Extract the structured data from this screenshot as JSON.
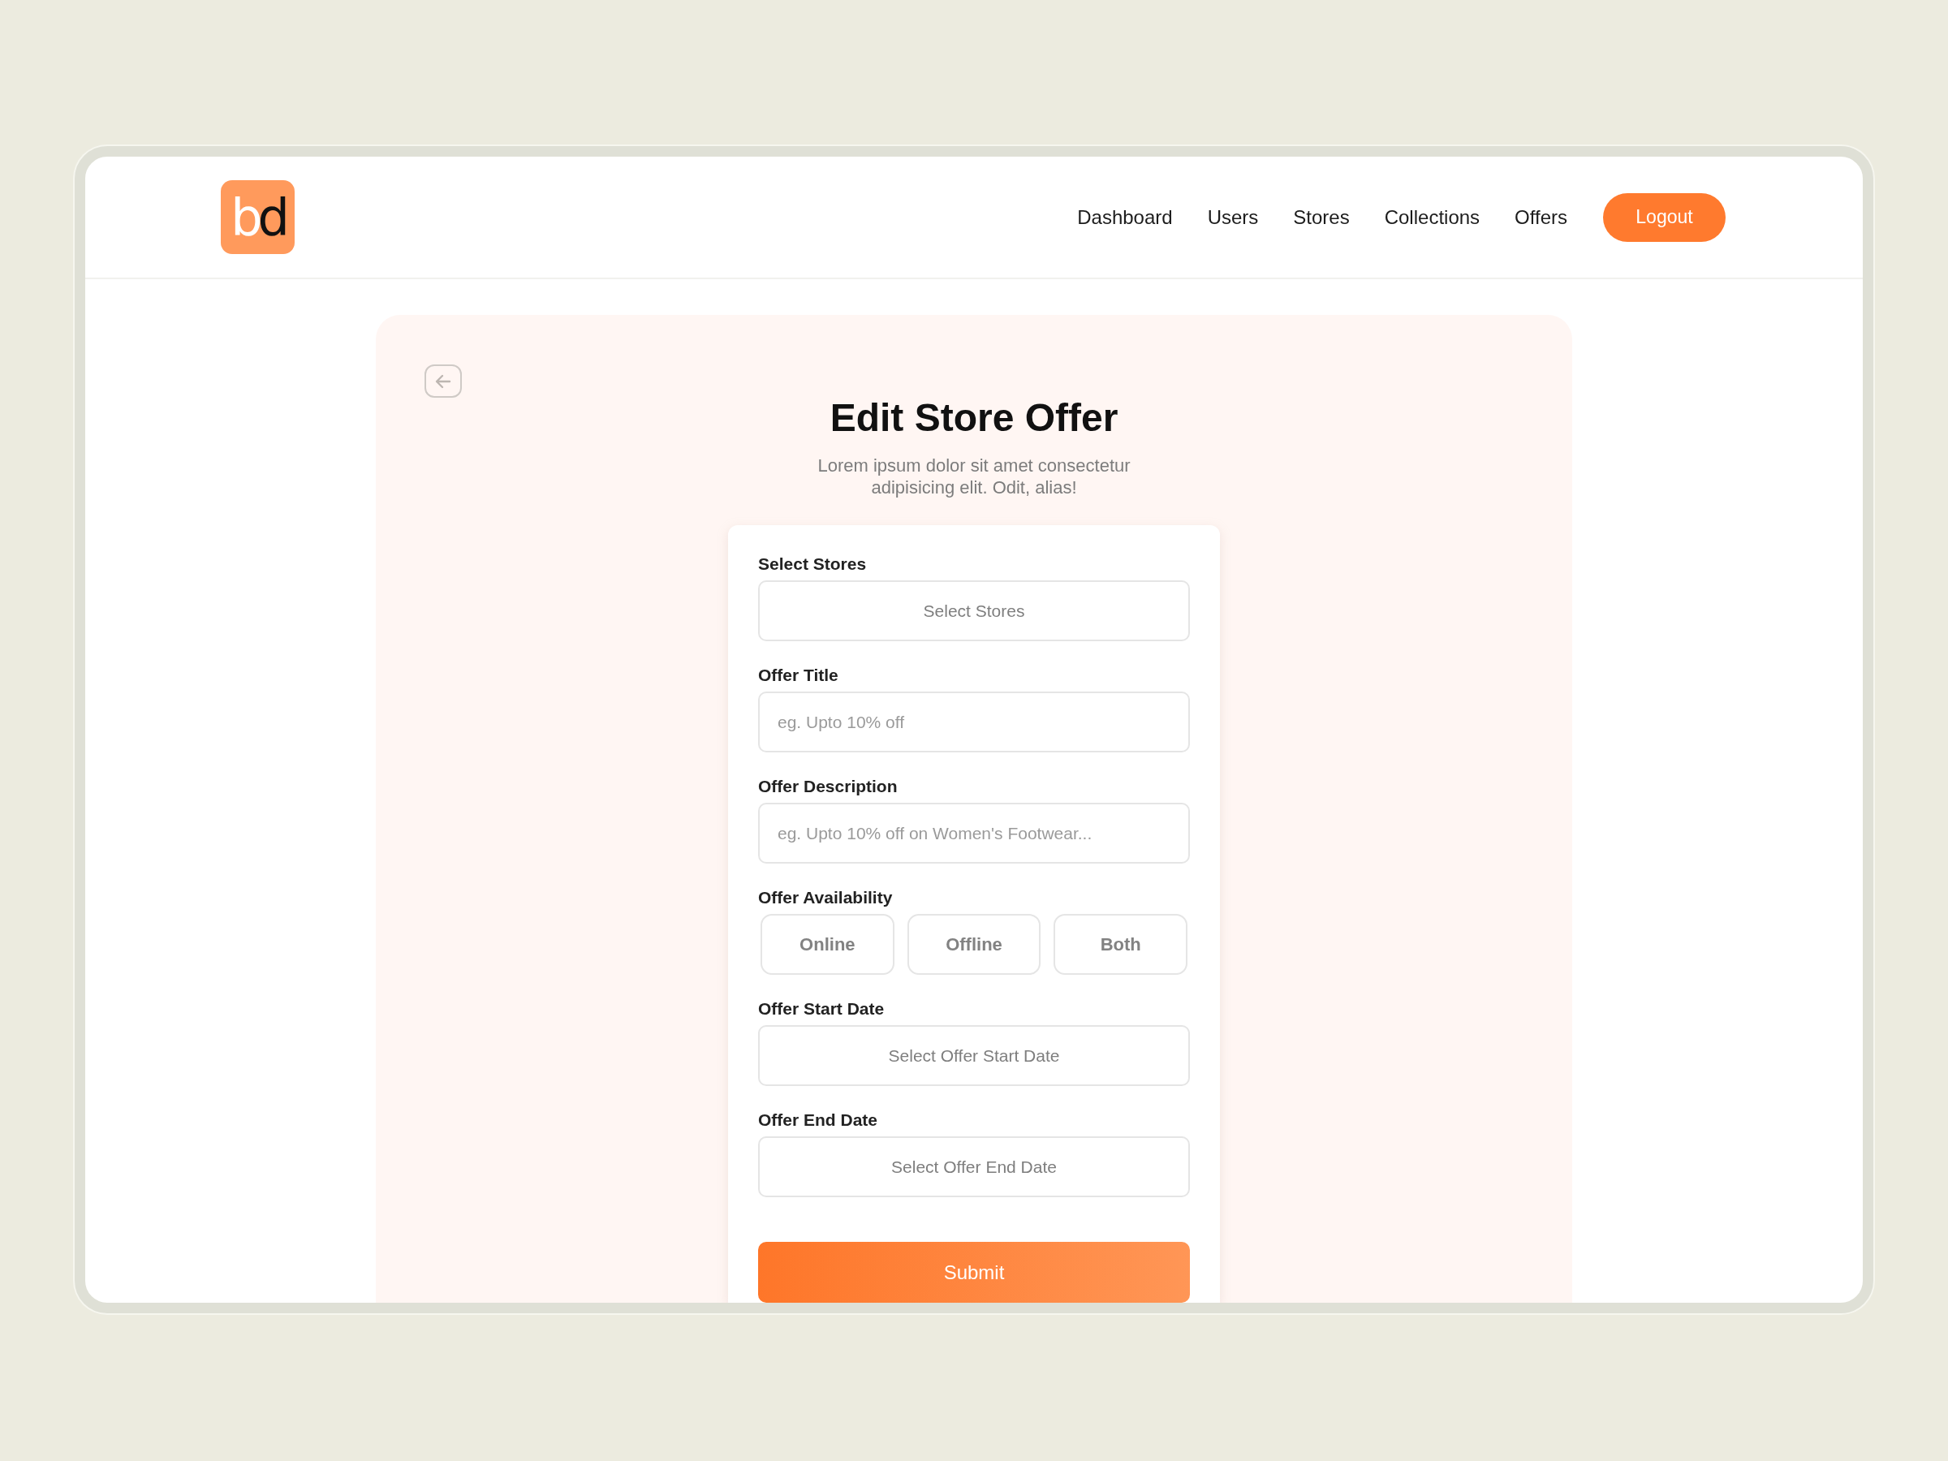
{
  "header": {
    "logo": {
      "letters": [
        {
          "char": "b",
          "color": "#ffffff"
        },
        {
          "char": "d",
          "color": "#111111"
        }
      ]
    },
    "nav": [
      {
        "label": "Dashboard",
        "selected": false
      },
      {
        "label": "Users",
        "selected": false
      },
      {
        "label": "Stores",
        "selected": false
      },
      {
        "label": "Collections",
        "selected": false
      },
      {
        "label": "Offers",
        "selected": false
      }
    ],
    "logout": "Logout"
  },
  "page": {
    "title": "Edit Store Offer",
    "subtitle": "Lorem ipsum dolor sit amet consectetur adipisicing elit. Odit, alias!"
  },
  "form": {
    "fields": [
      {
        "kind": "picker",
        "label": "Select Stores",
        "placeholder": "Select Stores"
      },
      {
        "kind": "text",
        "label": "Offer Title",
        "placeholder": "eg. Upto 10% off"
      },
      {
        "kind": "text",
        "label": "Offer Description",
        "placeholder": "eg. Upto 10% off on Women's Footwear..."
      },
      {
        "kind": "choice",
        "label": "Offer Availability",
        "options": [
          {
            "label": "Online",
            "selected": false
          },
          {
            "label": "Offline",
            "selected": false
          },
          {
            "label": "Both",
            "selected": false
          }
        ]
      },
      {
        "kind": "picker",
        "label": "Offer Start Date",
        "placeholder": "Select Offer Start Date"
      },
      {
        "kind": "picker",
        "label": "Offer End Date",
        "placeholder": "Select Offer End Date"
      }
    ],
    "submit": "Submit"
  }
}
